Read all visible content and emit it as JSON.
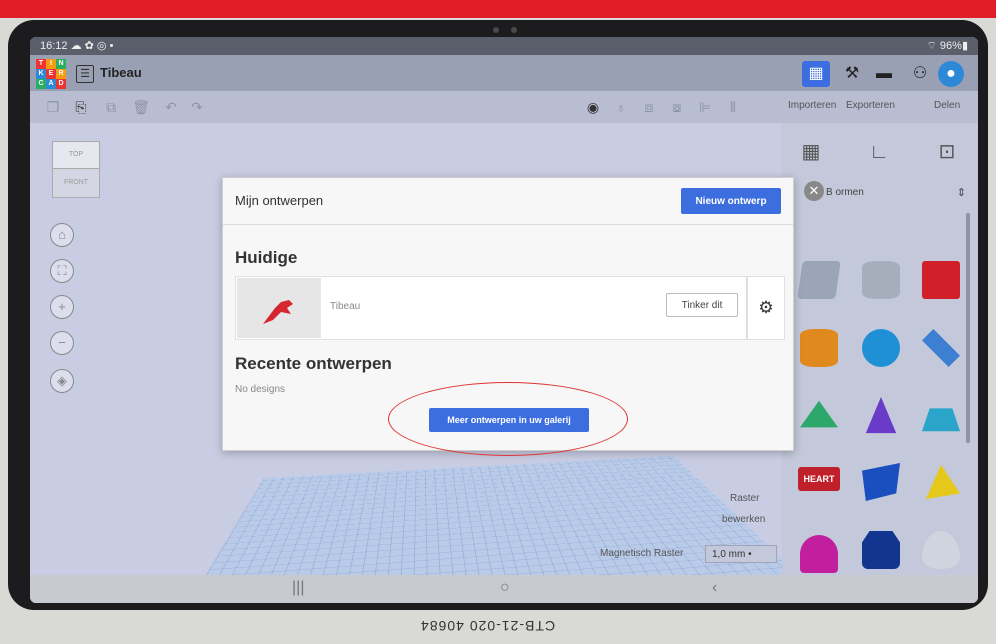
{
  "status": {
    "time": "16:12 ☁ ✿ ◎ •",
    "battery": "⌔ 96%▮"
  },
  "app": {
    "logo_letters": [
      "T",
      "I",
      "N",
      "K",
      "E",
      "R",
      "C",
      "A",
      "D"
    ],
    "doc_title": "Tibeau"
  },
  "toolbar": {
    "import_label": "Importeren",
    "export_label": "Exporteren",
    "share_label": "Delen"
  },
  "viewcube": {
    "top": "TOP",
    "front": "FRONT"
  },
  "panel": {
    "shapes_dropdown": "Basisvormen",
    "shapes_visible_partial": "B  ormen",
    "shape_label": "HEART"
  },
  "workplane": {
    "raster_line1": "Raster",
    "raster_line2": "bewerken",
    "snap_label": "Magnetisch Raster",
    "snap_value": "1,0 mm  •"
  },
  "dialog": {
    "title": "Mijn ontwerpen",
    "new_design_label": "Nieuw ontwerp",
    "current_heading": "Huidige",
    "current_design_name": "Tibeau",
    "tinker_label": "Tinker dit",
    "recent_heading": "Recente ontwerpen",
    "recent_empty": "No designs",
    "more_label": "Meer ontwerpen in uw galerij"
  },
  "device_label": "CTB-21-020  40684",
  "colors": {
    "accent": "#3d6ee0",
    "annotation": "#d33333"
  }
}
